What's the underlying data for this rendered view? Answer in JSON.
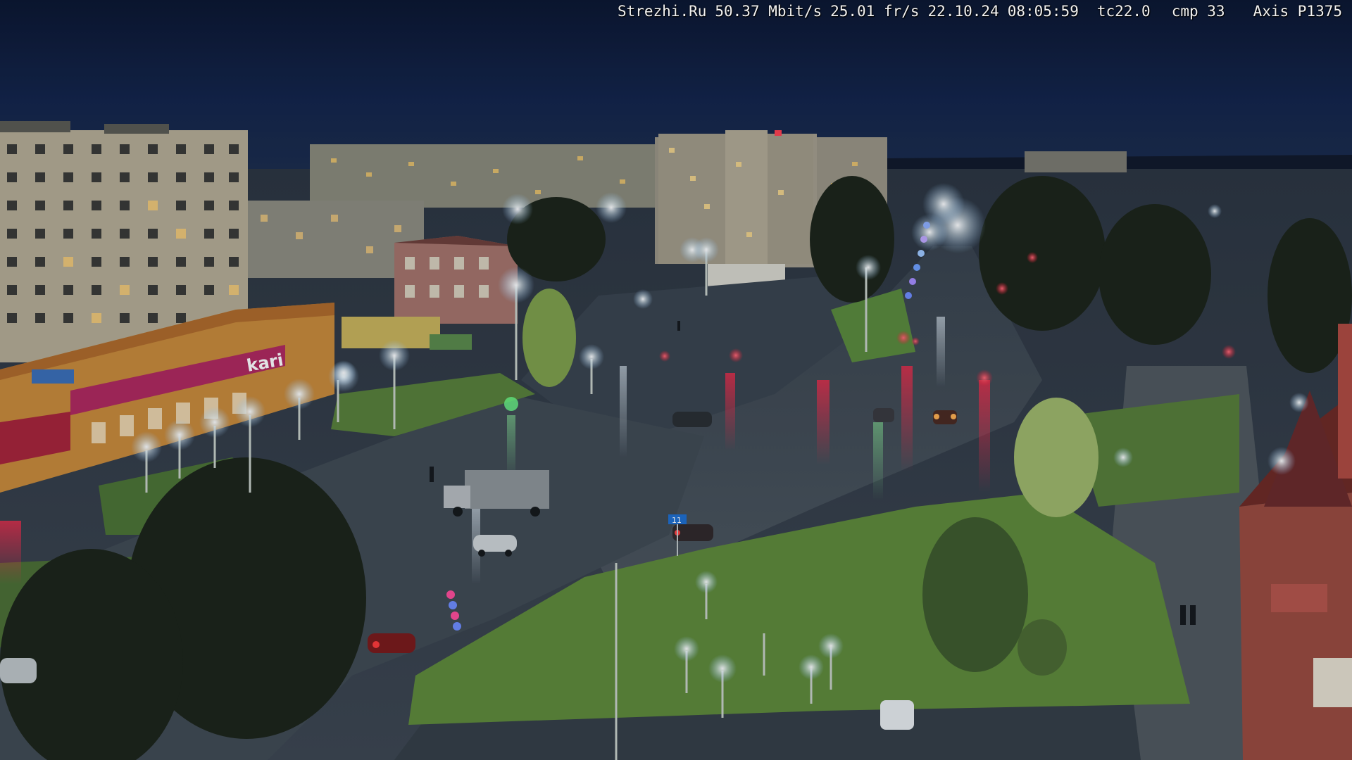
{
  "overlay": {
    "source": "Strezhi.Ru",
    "bitrate": "50.37 Mbit/s",
    "framerate": "25.01 fr/s",
    "date": "22.10.24",
    "time": "08:05:59",
    "tc": "tc22.0",
    "cmp": "cmp 33",
    "camera_model": "Axis P1375"
  },
  "signs": {
    "shop_sign": "kari",
    "bus_route": "11"
  },
  "colors": {
    "sky": "#0d1a36",
    "wet_asphalt": "#3a4752",
    "grass": "#5f8a3a",
    "street_light": "#f4fbff",
    "traffic_red": "#ff2a3a",
    "shop_sign_magenta": "#b0285e"
  }
}
